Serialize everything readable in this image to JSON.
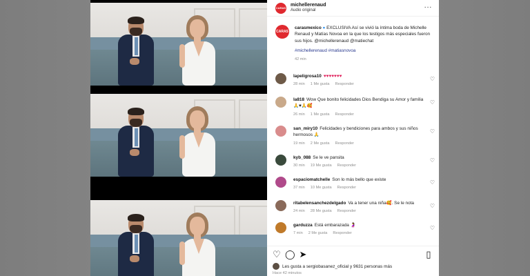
{
  "post": {
    "avatar_text": "CARAS",
    "username": "michellerenaud",
    "audio": "Audio original",
    "more": "···"
  },
  "caption": {
    "avatar_text": "CARAS",
    "username": "carasmexico",
    "text": "EXCLUSIVA Así se vivió la íntima boda de Michelle Renaud y Matías Novoa en la que los testigos más especiales fueron sus hijos. @michellerenaud @matiechat",
    "tags": "#michellerenaud #matiasnovoa",
    "time": "42 min"
  },
  "comments": [
    {
      "user": "lapeligrosa10",
      "text": "♥♥♥♥♥♥♥",
      "time": "28 min",
      "likes": "1 Me gusta",
      "reply": "Responder",
      "color": "#6e5a48"
    },
    {
      "user": "la818",
      "text": "Wow Que bonito felicidades Dios Bendiga su Amor y familia 🙏♥🙏🥰",
      "time": "26 min",
      "likes": "1 Me gusta",
      "reply": "Responder",
      "color": "#c9a98a"
    },
    {
      "user": "san_miry10",
      "text": "Felicidades y bendiciones para ambos y sus niños hermosos 🙏",
      "time": "19 min",
      "likes": "2 Me gusta",
      "reply": "Responder",
      "color": "#d98c8c"
    },
    {
      "user": "kyb_088",
      "text": "Se le ve pansita",
      "time": "30 min",
      "likes": "19 Me gusta",
      "reply": "Responder",
      "color": "#3a4a3c"
    },
    {
      "user": "espaciomatchelle",
      "text": "Son lo más bello que existe",
      "time": "37 min",
      "likes": "10 Me gusta",
      "reply": "Responder",
      "color": "#b04a8a"
    },
    {
      "user": "ritabelensanchezdelgado",
      "text": "Va a tener una niña🥰. Se le nota",
      "time": "24 min",
      "likes": "28 Me gusta",
      "reply": "Responder",
      "color": "#8a6a5a"
    },
    {
      "user": "garduzza",
      "text": "Está embarazada 🤰",
      "time": "7 min",
      "likes": "2 Me gusta",
      "reply": "Responder",
      "color": "#c07a2a"
    }
  ],
  "likes": {
    "text": "Les gusta a sergiobasanez_oficial y 9631 personas más"
  },
  "time_ago": "Hace 42 minutos"
}
